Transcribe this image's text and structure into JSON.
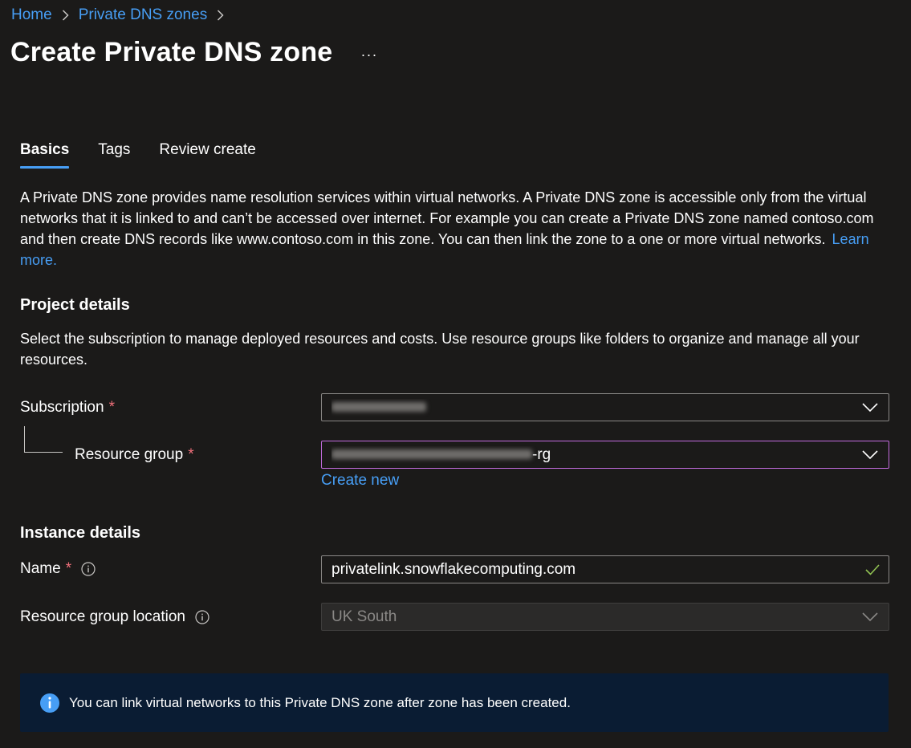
{
  "breadcrumb": {
    "home": "Home",
    "private_dns_zones": "Private DNS zones"
  },
  "page": {
    "title": "Create Private DNS zone",
    "more": "···"
  },
  "tabs": [
    {
      "label": "Basics",
      "active": true
    },
    {
      "label": "Tags",
      "active": false
    },
    {
      "label": "Review create",
      "active": false
    }
  ],
  "description": {
    "text": "A Private DNS zone provides name resolution services within virtual networks. A Private DNS zone is accessible only from the virtual networks that it is linked to and can’t be accessed over internet. For example you can create a Private DNS zone named contoso.com and then create DNS records like www.contoso.com in this zone. You can then link the zone to a one or more virtual networks.",
    "learn_more": "Learn more."
  },
  "project_details": {
    "heading": "Project details",
    "description": "Select the subscription to manage deployed resources and costs. Use resource groups like folders to organize and manage all your resources.",
    "subscription_label": "Subscription",
    "resource_group_label": "Resource group",
    "resource_group_value_suffix": "-rg",
    "create_new": "Create new",
    "required_mark": "*"
  },
  "instance_details": {
    "heading": "Instance details",
    "name_label": "Name",
    "name_value": "privatelink.snowflakecomputing.com",
    "location_label": "Resource group location",
    "location_value": "UK South"
  },
  "info_banner": {
    "text": "You can link virtual networks to this Private DNS zone after zone has been created."
  },
  "colors": {
    "background": "#1b1a19",
    "link": "#479ef5",
    "required": "#f1707b",
    "focus_border": "#c36cde",
    "valid_check": "#92c353",
    "banner_bg": "#0a1c33"
  }
}
